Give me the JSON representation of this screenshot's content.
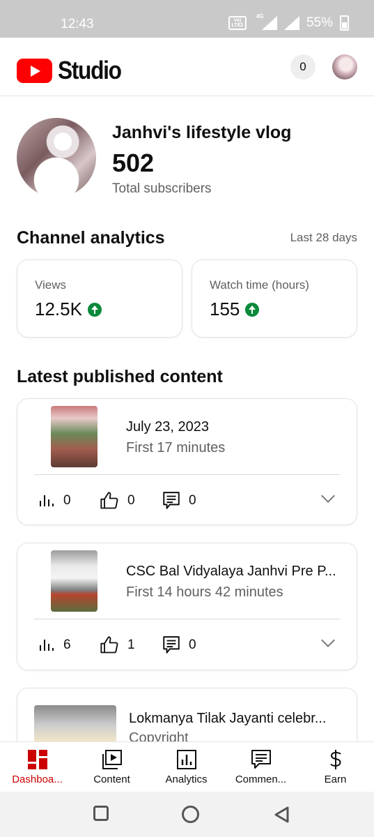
{
  "status_bar": {
    "time": "12:43",
    "volte": "Vo) LTE2",
    "network": "4G",
    "battery": "55%"
  },
  "header": {
    "app_name": "Studio",
    "notification_count": "0",
    "brand_color": "#ff0000"
  },
  "channel": {
    "name": "Janhvi's lifestyle vlog",
    "subscribers": "502",
    "subscribers_label": "Total subscribers"
  },
  "analytics": {
    "title": "Channel analytics",
    "period": "Last 28 days",
    "cards": [
      {
        "label": "Views",
        "value": "12.5K",
        "trend": "up"
      },
      {
        "label": "Watch time (hours)",
        "value": "155",
        "trend": "up"
      }
    ],
    "trend_color": "#0a8a3a"
  },
  "latest": {
    "title": "Latest published content",
    "items": [
      {
        "title": "July 23, 2023",
        "subtitle": "First 17 minutes",
        "views": "0",
        "likes": "0",
        "comments": "0"
      },
      {
        "title": "CSC Bal Vidyalaya Janhvi Pre P...",
        "subtitle": "First 14 hours 42 minutes",
        "views": "6",
        "likes": "1",
        "comments": "0"
      },
      {
        "title": "Lokmanya Tilak Jayanti celebr...",
        "subtitle": "Copyright"
      }
    ]
  },
  "bottom_nav": {
    "items": [
      {
        "label": "Dashboa...",
        "icon": "dashboard-icon",
        "active": true
      },
      {
        "label": "Content",
        "icon": "content-icon",
        "active": false
      },
      {
        "label": "Analytics",
        "icon": "analytics-icon",
        "active": false
      },
      {
        "label": "Commen...",
        "icon": "comments-icon",
        "active": false
      },
      {
        "label": "Earn",
        "icon": "dollar-icon",
        "active": false
      }
    ],
    "active_color": "#cc0000"
  }
}
